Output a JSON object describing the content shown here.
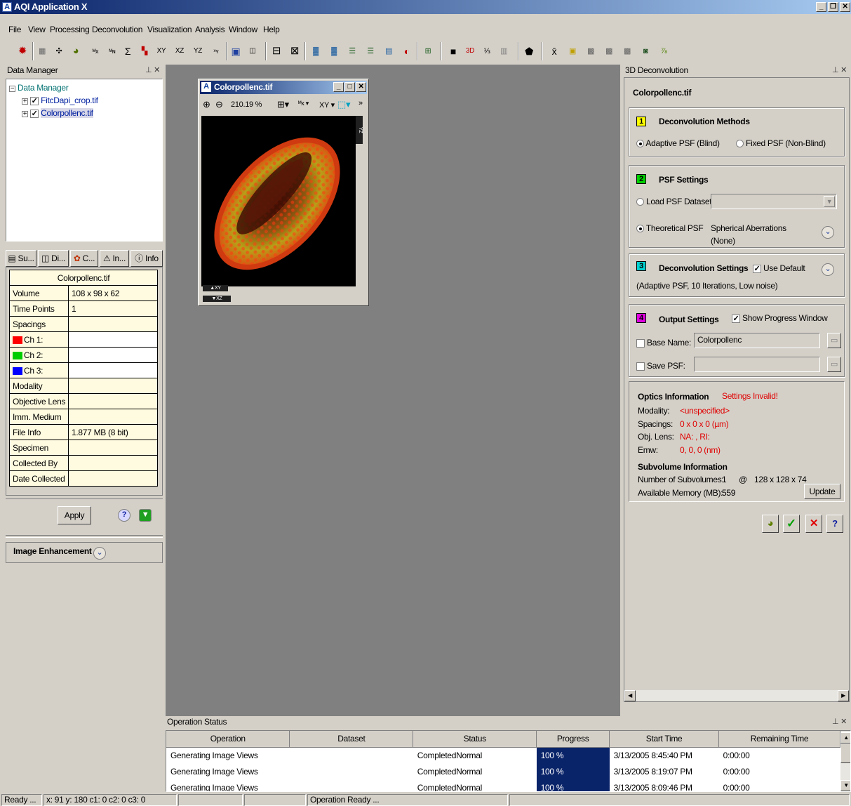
{
  "app": {
    "title": "AQI Application X"
  },
  "menu": [
    "File",
    "View",
    "Processing",
    "Deconvolution",
    "Visualization",
    "Analysis",
    "Window",
    "Help"
  ],
  "toolbar": {
    "icons": [
      "bug-icon",
      "grid-icon",
      "crosshair-icon",
      "clock-icon",
      "max-x-icon",
      "min-n-icon",
      "sum-icon",
      "channel-icon",
      "xy-icon",
      "xz-icon",
      "yz-icon",
      "xyz-icon",
      "save-icon",
      "folder-icon",
      "fit-icon",
      "fullscreen-icon",
      "filter-icon",
      "filter2-icon",
      "align-icon",
      "align2-icon",
      "merge-icon",
      "color-icon",
      "crop-icon",
      "cube-icon",
      "3d-icon",
      "ratio-icon",
      "stack-icon",
      "shield-icon",
      "mean-icon",
      "ruler-icon",
      "mosaic-icon",
      "mosaic2-icon",
      "mosaic3-icon",
      "fill-icon",
      "ratio2-icon"
    ],
    "labels": {
      "xy": "XY",
      "xz": "XZ",
      "yz": "YZ",
      "threeD": "3D",
      "sum": "Σ",
      "mean": "x̄"
    }
  },
  "data_manager": {
    "title": "Data Manager",
    "root": "Data Manager",
    "items": [
      "FitcDapi_crop.tif",
      "Colorpollenc.tif"
    ]
  },
  "tabs": [
    "Su...",
    "Di...",
    "C...",
    "In...",
    "Info"
  ],
  "properties": {
    "filename": "Colorpollenc.tif",
    "rows": [
      {
        "label": "Volume",
        "value": "108 x 98 x 62"
      },
      {
        "label": "Time Points",
        "value": "1"
      },
      {
        "label": "Spacings",
        "value": ""
      },
      {
        "label": "Ch 1:",
        "value": "",
        "color": "#ff0000"
      },
      {
        "label": "Ch 2:",
        "value": "",
        "color": "#00cc00"
      },
      {
        "label": "Ch 3:",
        "value": "",
        "color": "#0000ff"
      },
      {
        "label": "Modality",
        "value": ""
      },
      {
        "label": "Objective Lens",
        "value": ""
      },
      {
        "label": "Imm. Medium",
        "value": ""
      },
      {
        "label": "File Info",
        "value": "1.877 MB (8 bit)"
      },
      {
        "label": "Specimen",
        "value": ""
      },
      {
        "label": "Collected By",
        "value": ""
      },
      {
        "label": "Date Collected",
        "value": ""
      }
    ],
    "apply_label": "Apply"
  },
  "image_enhancement": {
    "label": "Image Enhancement"
  },
  "image_window": {
    "title": "Colorpollenc.tif",
    "zoom": "210.19 %",
    "view": "XY",
    "side_label": "YZ",
    "bottom_labels": [
      "XY",
      "XZ"
    ]
  },
  "deconv": {
    "panel_title": "3D Deconvolution",
    "filename": "Colorpollenc.tif",
    "methods": {
      "num": "1",
      "title": "Deconvolution Methods",
      "opt1": "Adaptive PSF (Blind)",
      "opt2": "Fixed PSF (Non-Blind)"
    },
    "psf": {
      "num": "2",
      "title": "PSF Settings",
      "load": "Load PSF Dataset:",
      "theoretical": "Theoretical PSF",
      "spherical": "Spherical Aberrations",
      "none": "(None)"
    },
    "settings": {
      "num": "3",
      "title": "Deconvolution Settings",
      "use_default": "Use Default",
      "summary": "(Adaptive PSF, 10 Iterations, Low noise)"
    },
    "output": {
      "num": "4",
      "title": "Output Settings",
      "show_progress": "Show Progress Window",
      "base_name_label": "Base Name:",
      "base_name_value": "Colorpollenc",
      "save_psf": "Save PSF:"
    },
    "optics": {
      "title": "Optics Information",
      "invalid": "Settings Invalid!",
      "rows": [
        {
          "label": "Modality:",
          "value": "<unspecified>"
        },
        {
          "label": "Spacings:",
          "value": "0 x 0 x 0 (µm)"
        },
        {
          "label": "Obj. Lens:",
          "value": "NA: ,    RI:"
        },
        {
          "label": "Emw:",
          "value": "0, 0, 0 (nm)"
        }
      ]
    },
    "subvolume": {
      "title": "Subvolume Information",
      "num_label": "Number of Subvolumes:",
      "num_value": "1",
      "at": "@",
      "dims": "128 x 128 x 74",
      "mem_label": "Available Memory (MB):",
      "mem_value": "559",
      "update": "Update"
    }
  },
  "operations": {
    "title": "Operation Status",
    "columns": [
      "Operation",
      "Dataset",
      "Status",
      "Progress",
      "Start Time",
      "Remaining Time"
    ],
    "rows": [
      {
        "operation": "Generating Image Views",
        "dataset": "",
        "status": "CompletedNormal",
        "progress": "100 %",
        "start": "3/13/2005 8:45:40 PM",
        "remaining": "0:00:00"
      },
      {
        "operation": "Generating Image Views",
        "dataset": "",
        "status": "CompletedNormal",
        "progress": "100 %",
        "start": "3/13/2005 8:19:07 PM",
        "remaining": "0:00:00"
      },
      {
        "operation": "Generating Image Views",
        "dataset": "",
        "status": "CompletedNormal",
        "progress": "100 %",
        "start": "3/13/2005 8:09:46 PM",
        "remaining": "0:00:00"
      }
    ]
  },
  "statusbar": {
    "ready": "Ready ...",
    "coords": "x: 91 y: 180 c1: 0 c2: 0 c3: 0",
    "operation": "Operation Ready ..."
  }
}
